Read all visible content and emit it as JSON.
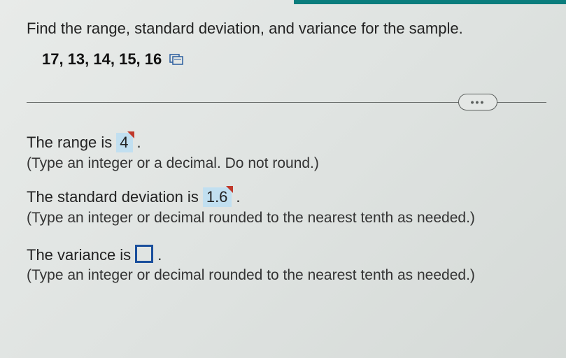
{
  "header_bar_color": "#0a7d7d",
  "prompt": "Find the range, standard deviation, and variance for the sample.",
  "data_values": "17, 13, 14, 15, 16",
  "icons": {
    "calculator": "calculator-icon",
    "more": "…"
  },
  "divider_more_label": "...",
  "answers": {
    "range": {
      "prefix": "The range is",
      "value": "4",
      "suffix": ".",
      "hint": "(Type an integer or a decimal. Do not round.)"
    },
    "stddev": {
      "prefix": "The standard deviation is",
      "value": "1.6",
      "suffix": ".",
      "hint": "(Type an integer or decimal rounded to the nearest tenth as needed.)"
    },
    "variance": {
      "prefix": "The variance is",
      "value": "",
      "suffix": ".",
      "hint": "(Type an integer or decimal rounded to the nearest tenth as needed.)"
    }
  }
}
